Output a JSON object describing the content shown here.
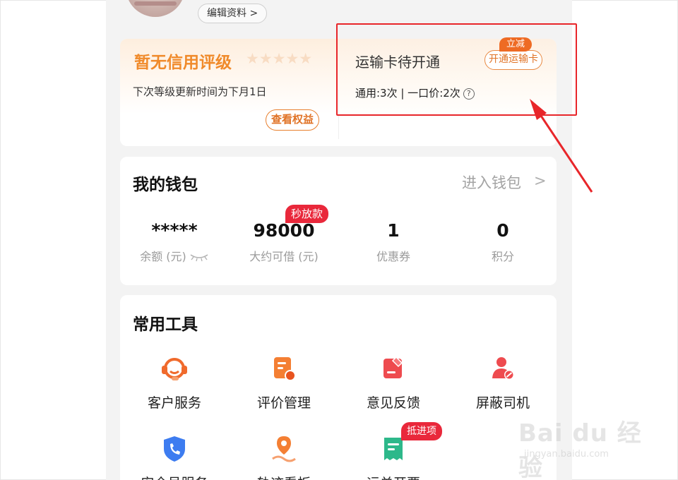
{
  "profile": {
    "edit_label": "编辑资料 >"
  },
  "credit": {
    "title": "暂无信用评级",
    "stars": "★★★★★",
    "update_text": "下次等级更新时间为下月1日",
    "rights_button": "查看权益"
  },
  "transport_card": {
    "title": "运输卡待开通",
    "open_button": "开通运输卡",
    "discount_badge": "立减",
    "usage": "通用:3次 | 一口价:2次",
    "help_icon": "?"
  },
  "wallet": {
    "title": "我的钱包",
    "enter_label": "进入钱包",
    "chevron": ">",
    "fast_badge": "秒放款",
    "stats": [
      {
        "value": "*****",
        "label": "余额 (元)"
      },
      {
        "value": "98000",
        "label": "大约可借 (元)"
      },
      {
        "value": "1",
        "label": "优惠券"
      },
      {
        "value": "0",
        "label": "积分"
      }
    ]
  },
  "tools": {
    "title": "常用工具",
    "items": [
      {
        "label": "客户服务",
        "icon": "headset-icon"
      },
      {
        "label": "评价管理",
        "icon": "review-doc-icon"
      },
      {
        "label": "意见反馈",
        "icon": "feedback-icon"
      },
      {
        "label": "屏蔽司机",
        "icon": "block-driver-icon"
      },
      {
        "label": "安全号服务",
        "icon": "security-phone-icon"
      },
      {
        "label": "轨迹看板",
        "icon": "location-track-icon"
      },
      {
        "label": "运单开票",
        "icon": "invoice-icon"
      }
    ],
    "invoice_badge": "抵进项"
  },
  "watermark": {
    "brand": "Bai du 经验",
    "url": "jingyan.baidu.com"
  },
  "colors": {
    "accent_orange": "#f08a2a",
    "badge_red": "#e9283b",
    "annotation_red": "#e8262a"
  }
}
